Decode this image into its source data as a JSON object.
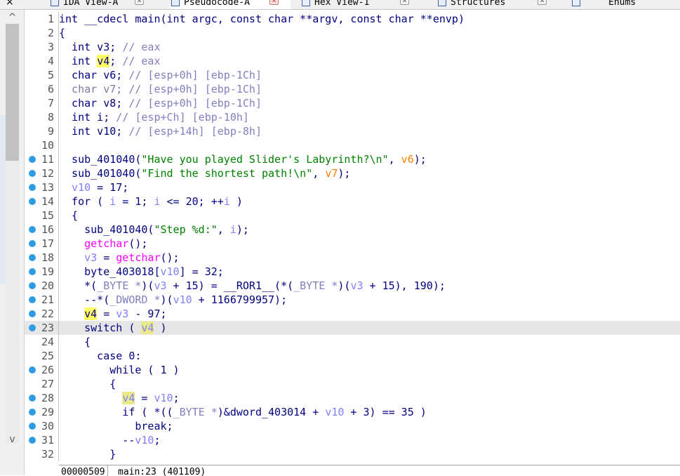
{
  "tabs": [
    {
      "label": "IDA View-A",
      "active": false,
      "close": "×"
    },
    {
      "label": "Pseudocode-A",
      "active": true,
      "close": "×"
    },
    {
      "label": "Hex View-1",
      "active": false,
      "close": "×"
    },
    {
      "label": "Structures",
      "active": false,
      "close": "×"
    },
    {
      "label": "Enums",
      "active": false,
      "close": ""
    }
  ],
  "window_close": "×",
  "scroll": {
    "up": "^",
    "down": "v"
  },
  "code": {
    "lines": [
      {
        "n": "1",
        "bp": false,
        "tokens": [
          [
            "kw",
            "int __cdecl main(int argc, const char **argv, const char **envp)"
          ]
        ]
      },
      {
        "n": "2",
        "bp": false,
        "tokens": [
          [
            "kw",
            "{"
          ]
        ]
      },
      {
        "n": "3",
        "bp": false,
        "tokens": [
          [
            "kw",
            "  int v3; "
          ],
          [
            "cm",
            "// eax"
          ]
        ]
      },
      {
        "n": "4",
        "bp": false,
        "tokens": [
          [
            "kw",
            "  int "
          ],
          [
            "hl",
            "v4"
          ],
          [
            "kw",
            "; "
          ],
          [
            "cm",
            "// eax"
          ]
        ]
      },
      {
        "n": "5",
        "bp": false,
        "tokens": [
          [
            "kw",
            "  char v6; "
          ],
          [
            "cm",
            "// [esp+0h] [ebp-1Ch]"
          ]
        ]
      },
      {
        "n": "6",
        "bp": false,
        "tokens": [
          [
            "gr",
            "  char v7; "
          ],
          [
            "cm",
            "// [esp+0h] [ebp-1Ch]"
          ]
        ]
      },
      {
        "n": "7",
        "bp": false,
        "tokens": [
          [
            "kw",
            "  char v8; "
          ],
          [
            "cm",
            "// [esp+0h] [ebp-1Ch]"
          ]
        ]
      },
      {
        "n": "8",
        "bp": false,
        "tokens": [
          [
            "kw",
            "  int i; "
          ],
          [
            "cm",
            "// [esp+Ch] [ebp-10h]"
          ]
        ]
      },
      {
        "n": "9",
        "bp": false,
        "tokens": [
          [
            "kw",
            "  int v10; "
          ],
          [
            "cm",
            "// [esp+14h] [ebp-8h]"
          ]
        ]
      },
      {
        "n": "10",
        "bp": false,
        "tokens": [
          [
            "kw",
            ""
          ]
        ]
      },
      {
        "n": "11",
        "bp": true,
        "tokens": [
          [
            "fn",
            "  sub_401040("
          ],
          [
            "str",
            "\"Have you played Slider's Labyrinth?\\n\""
          ],
          [
            "fn",
            ", "
          ],
          [
            "arg",
            "v6"
          ],
          [
            "fn",
            ");"
          ]
        ]
      },
      {
        "n": "12",
        "bp": true,
        "tokens": [
          [
            "fn",
            "  sub_401040("
          ],
          [
            "str",
            "\"Find the shortest path!\\n\""
          ],
          [
            "fn",
            ", "
          ],
          [
            "arg",
            "v7"
          ],
          [
            "fn",
            ");"
          ]
        ]
      },
      {
        "n": "13",
        "bp": true,
        "tokens": [
          [
            "var",
            "  v10"
          ],
          [
            "kw",
            " = 17;"
          ]
        ]
      },
      {
        "n": "14",
        "bp": true,
        "tokens": [
          [
            "kw",
            "  for ( "
          ],
          [
            "var",
            "i"
          ],
          [
            "kw",
            " = 1; "
          ],
          [
            "var",
            "i"
          ],
          [
            "kw",
            " <= 20; ++"
          ],
          [
            "var",
            "i"
          ],
          [
            "kw",
            " )"
          ]
        ]
      },
      {
        "n": "15",
        "bp": false,
        "tokens": [
          [
            "kw",
            "  {"
          ]
        ]
      },
      {
        "n": "16",
        "bp": true,
        "tokens": [
          [
            "fn",
            "    sub_401040("
          ],
          [
            "str",
            "\"Step %d:\""
          ],
          [
            "fn",
            ", "
          ],
          [
            "var",
            "i"
          ],
          [
            "fn",
            ");"
          ]
        ]
      },
      {
        "n": "17",
        "bp": true,
        "tokens": [
          [
            "lib",
            "    getchar"
          ],
          [
            "kw",
            "();"
          ]
        ]
      },
      {
        "n": "18",
        "bp": true,
        "tokens": [
          [
            "var",
            "    v3"
          ],
          [
            "kw",
            " = "
          ],
          [
            "lib",
            "getchar"
          ],
          [
            "kw",
            "();"
          ]
        ]
      },
      {
        "n": "19",
        "bp": true,
        "tokens": [
          [
            "kw",
            "    byte_403018["
          ],
          [
            "var",
            "v10"
          ],
          [
            "kw",
            "] = 32;"
          ]
        ]
      },
      {
        "n": "20",
        "bp": true,
        "tokens": [
          [
            "kw",
            "    *("
          ],
          [
            "cm",
            "_BYTE *"
          ],
          [
            "kw",
            ")("
          ],
          [
            "var",
            "v3"
          ],
          [
            "kw",
            " + 15) = __ROR1__(*("
          ],
          [
            "cm",
            "_BYTE *"
          ],
          [
            "kw",
            ")("
          ],
          [
            "var",
            "v3"
          ],
          [
            "kw",
            " + 15), 190);"
          ]
        ]
      },
      {
        "n": "21",
        "bp": true,
        "tokens": [
          [
            "kw",
            "    --*("
          ],
          [
            "cm",
            "_DWORD *"
          ],
          [
            "kw",
            ")("
          ],
          [
            "var",
            "v10"
          ],
          [
            "kw",
            " + 1166799957);"
          ]
        ]
      },
      {
        "n": "22",
        "bp": true,
        "tokens": [
          [
            "kw",
            "    "
          ],
          [
            "hl",
            "v4"
          ],
          [
            "kw",
            " = "
          ],
          [
            "var",
            "v3"
          ],
          [
            "kw",
            " - 97;"
          ]
        ]
      },
      {
        "n": "23",
        "bp": true,
        "cur": true,
        "tokens": [
          [
            "kw",
            "    switch ( "
          ],
          [
            "hlv",
            "v4"
          ],
          [
            "kw",
            " )"
          ]
        ]
      },
      {
        "n": "24",
        "bp": false,
        "tokens": [
          [
            "kw",
            "    {"
          ]
        ]
      },
      {
        "n": "25",
        "bp": false,
        "tokens": [
          [
            "kw",
            "      case 0:"
          ]
        ]
      },
      {
        "n": "26",
        "bp": true,
        "tokens": [
          [
            "kw",
            "        while ( 1 )"
          ]
        ]
      },
      {
        "n": "27",
        "bp": false,
        "tokens": [
          [
            "kw",
            "        {"
          ]
        ]
      },
      {
        "n": "28",
        "bp": true,
        "tokens": [
          [
            "kw",
            "          "
          ],
          [
            "hlv",
            "v4"
          ],
          [
            "kw",
            " = "
          ],
          [
            "var",
            "v10"
          ],
          [
            "kw",
            ";"
          ]
        ]
      },
      {
        "n": "29",
        "bp": true,
        "tokens": [
          [
            "kw",
            "          if ( *(("
          ],
          [
            "cm",
            "_BYTE *"
          ],
          [
            "kw",
            ")&dword_403014 + "
          ],
          [
            "var",
            "v10"
          ],
          [
            "kw",
            " + 3) == 35 )"
          ]
        ]
      },
      {
        "n": "30",
        "bp": true,
        "tokens": [
          [
            "kw",
            "            break;"
          ]
        ]
      },
      {
        "n": "31",
        "bp": true,
        "tokens": [
          [
            "kw",
            "          --"
          ],
          [
            "var",
            "v10"
          ],
          [
            "kw",
            ";"
          ]
        ]
      },
      {
        "n": "32",
        "bp": false,
        "tokens": [
          [
            "kw",
            "        }"
          ]
        ]
      }
    ]
  },
  "status": {
    "address": "00000509",
    "location": "main:23 (401109)"
  }
}
